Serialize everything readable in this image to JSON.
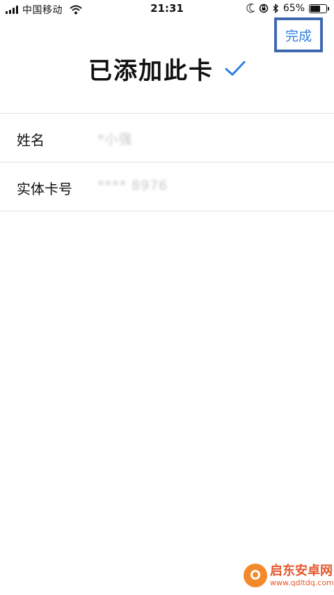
{
  "status_bar": {
    "carrier": "中国移动",
    "time": "21:31",
    "battery_percent_label": "65%",
    "battery_level": 0.65,
    "signal_bars": 4,
    "icons": [
      "signal-icon",
      "wifi-icon",
      "moon-icon",
      "orientation-lock-icon",
      "bluetooth-icon",
      "battery-icon"
    ]
  },
  "header": {
    "done_label": "完成",
    "title": "已添加此卡",
    "check_icon": "checkmark-icon"
  },
  "form": {
    "rows": [
      {
        "label": "姓名",
        "value": "*小强"
      },
      {
        "label": "实体卡号",
        "value": "**** 8976"
      }
    ]
  },
  "watermark": {
    "title": "启东安卓网",
    "url": "www.qdltdq.com"
  },
  "colors": {
    "accent": "#2f7ee0",
    "highlight_frame": "#3e69ad",
    "divider": "#e2e2e2",
    "watermark": "#e4572e"
  }
}
